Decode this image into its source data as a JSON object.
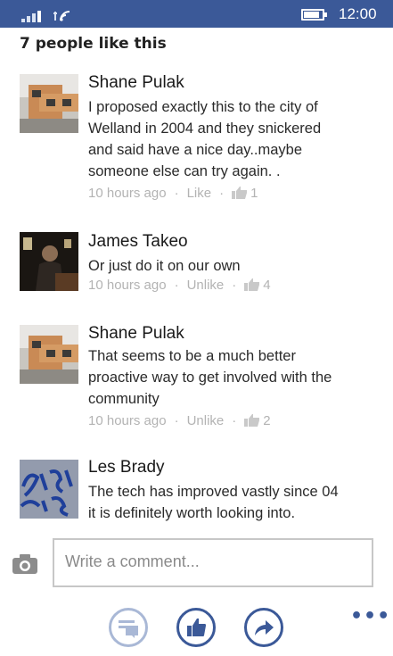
{
  "status_bar": {
    "time": "12:00",
    "background": "#3b5998"
  },
  "likes_header": "7 people like this",
  "comments": [
    {
      "author": "Shane Pulak",
      "text_lines": [
        "I proposed exactly this to the city of",
        "Welland in 2004 and they snickered",
        "and said have a nice day..maybe",
        "someone else can try again. ."
      ],
      "time": "10 hours ago",
      "action": "Like",
      "like_count": "1",
      "avatar": "house-photo"
    },
    {
      "author": "James Takeo",
      "text_lines": [
        "Or just do it on our own"
      ],
      "time": "10 hours ago",
      "action": "Unlike",
      "like_count": "4",
      "avatar": "dark-portrait-photo"
    },
    {
      "author": "Shane Pulak",
      "text_lines": [
        "That seems to be a much better",
        "proactive way to get involved with the",
        "community"
      ],
      "time": "10 hours ago",
      "action": "Unlike",
      "like_count": "2",
      "avatar": "house-photo"
    },
    {
      "author": "Les Brady",
      "text_lines": [
        "The tech has improved vastly since 04",
        "it is definitely worth looking into."
      ],
      "avatar": "stay-weird-graffiti-photo"
    }
  ],
  "comment_input": {
    "placeholder": "Write a comment..."
  },
  "icons": {
    "camera": "camera-icon",
    "comments": "comments-icon",
    "like": "thumbs-up-icon",
    "share": "share-arrow-icon",
    "more": "more-icon"
  },
  "colors": {
    "accent": "#3b5998",
    "meta_text": "#b3b3b3",
    "input_border": "#c7c7c7"
  }
}
